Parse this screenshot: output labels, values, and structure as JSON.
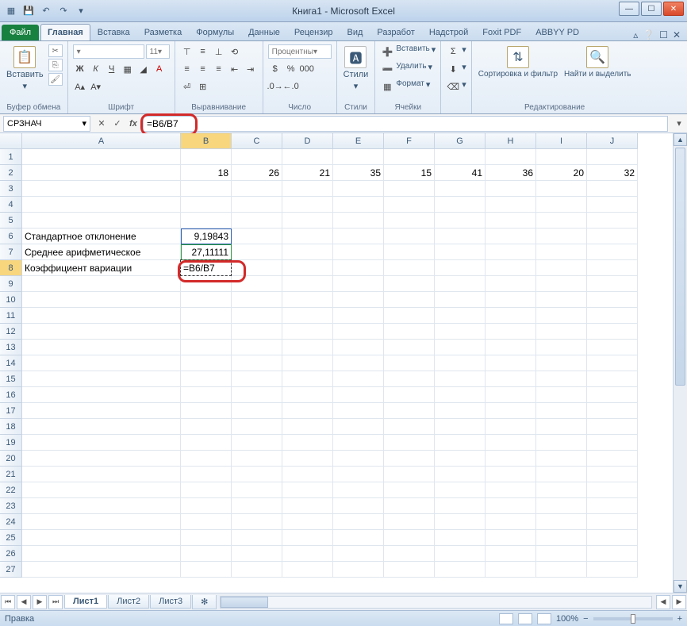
{
  "window": {
    "title": "Книга1 - Microsoft Excel"
  },
  "qat": {
    "save": "💾",
    "undo": "↶",
    "redo": "↷"
  },
  "tabs": {
    "file": "Файл",
    "items": [
      "Главная",
      "Вставка",
      "Разметка",
      "Формулы",
      "Данные",
      "Рецензир",
      "Вид",
      "Разработ",
      "Надстрой",
      "Foxit PDF",
      "ABBYY PD"
    ],
    "active": 0
  },
  "ribbon": {
    "clipboard": {
      "label": "Буфер обмена",
      "paste": "Вставить"
    },
    "font": {
      "label": "Шрифт",
      "size": "11"
    },
    "align": {
      "label": "Выравнивание"
    },
    "number": {
      "label": "Число",
      "format": "Процентны"
    },
    "styles": {
      "label": "Стили",
      "btn": "Стили"
    },
    "cells": {
      "label": "Ячейки",
      "insert": "Вставить",
      "delete": "Удалить",
      "format": "Формат"
    },
    "editing": {
      "label": "Редактирование",
      "sort": "Сортировка и фильтр",
      "find": "Найти и выделить"
    }
  },
  "formulabar": {
    "namebox": "СРЗНАЧ",
    "formula": "=B6/B7"
  },
  "columns": [
    "A",
    "B",
    "C",
    "D",
    "E",
    "F",
    "G",
    "H",
    "I",
    "J"
  ],
  "data": {
    "row2": [
      "18",
      "26",
      "21",
      "35",
      "15",
      "41",
      "36",
      "20",
      "32"
    ],
    "a6": "Стандартное отклонение",
    "b6": "9,19843",
    "a7": "Среднее арифметическое",
    "b7": "27,11111",
    "a8": "Коэффициент вариации",
    "b8": "=B6/B7"
  },
  "sheets": {
    "items": [
      "Лист1",
      "Лист2",
      "Лист3"
    ],
    "active": 0
  },
  "status": {
    "mode": "Правка",
    "zoom": "100%"
  }
}
